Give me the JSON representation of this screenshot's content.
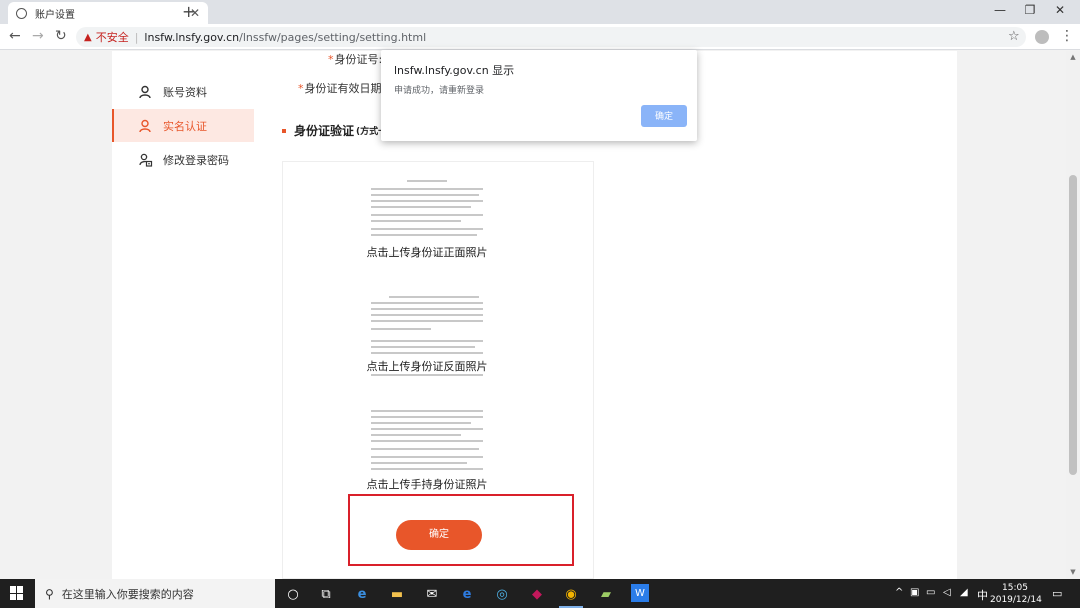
{
  "browser": {
    "tab_title": "账户设置",
    "tab_close": "✕",
    "new_tab": "+",
    "window": {
      "minimize": "—",
      "maximize": "❐",
      "close": "✕"
    },
    "nav": {
      "back": "←",
      "forward": "→",
      "reload": "↻"
    },
    "insecure_label": "不安全",
    "separator": "|",
    "url_host": "lnsfw.lnsfy.gov.cn",
    "url_path": "/lnssfw/pages/setting/setting.html",
    "star": "☆",
    "menu": "⋮"
  },
  "sidebar": {
    "items": [
      {
        "label": "账号资料",
        "icon": "user-icon",
        "active": false
      },
      {
        "label": "实名认证",
        "icon": "user-verify-icon",
        "active": true
      },
      {
        "label": "修改登录密码",
        "icon": "lock-icon",
        "active": false
      }
    ]
  },
  "form": {
    "id_number_label": "身份证号:",
    "id_expiry_label": "身份证有效日期:",
    "required_mark": "*",
    "section_title": "身份证验证",
    "section_sub": "(方式一",
    "uploads": [
      {
        "label": "点击上传身份证正面照片"
      },
      {
        "label": "点击上传身份证反面照片"
      },
      {
        "label": "点击上传手持身份证照片"
      }
    ],
    "confirm_label": "确定"
  },
  "dialog": {
    "title": "lnsfw.lnsfy.gov.cn 显示",
    "message": "申请成功，请重新登录",
    "ok_label": "确定"
  },
  "taskbar": {
    "search_placeholder": "在这里输入你要搜索的内容",
    "ime": "中",
    "time": "15:05",
    "date": "2019/12/14"
  },
  "colors": {
    "accent": "#e8562a",
    "highlight": "#d9202a",
    "dialog_button": "#8ab4f8"
  }
}
